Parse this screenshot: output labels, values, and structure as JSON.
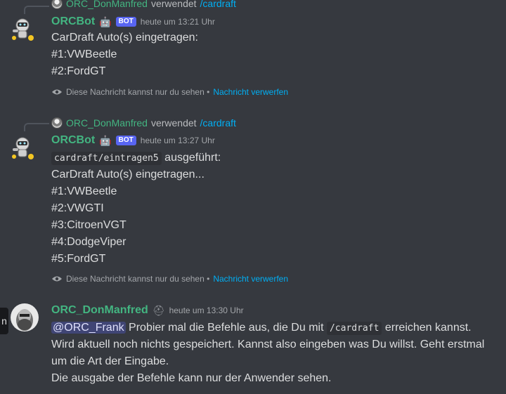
{
  "messages": [
    {
      "reply": {
        "user": "ORC_DonManfred",
        "verb": "verwendet",
        "command": "/cardraft"
      },
      "author": "ORCBot",
      "bot_tag": "BOT",
      "timestamp": "heute um 13:21 Uhr",
      "lines": [
        "CarDraft Auto(s) eingetragen:",
        "#1:VWBeetle",
        "#2:FordGT"
      ],
      "ephemeral_text": "Diese Nachricht kannst nur du sehen •",
      "ephemeral_link": "Nachricht verwerfen"
    },
    {
      "reply": {
        "user": "ORC_DonManfred",
        "verb": "verwendet",
        "command": "/cardraft"
      },
      "author": "ORCBot",
      "bot_tag": "BOT",
      "timestamp": "heute um 13:27 Uhr",
      "code": "cardraft/eintragen5",
      "code_suffix": "ausgeführt:",
      "lines": [
        "CarDraft Auto(s) eingetragen...",
        "#1:VWBeetle",
        "#2:VWGTI",
        "#3:CitroenVGT",
        "#4:DodgeViper",
        "#5:FordGT"
      ],
      "ephemeral_text": "Diese Nachricht kannst nur du sehen •",
      "ephemeral_link": "Nachricht verwerfen"
    },
    {
      "author": "ORC_DonManfred",
      "timestamp": "heute um 13:30 Uhr",
      "mention": "@ORC_Frank",
      "text_before_code": "Probier mal die Befehle aus, die Du mit",
      "code": "/cardraft",
      "text_after_code": "erreichen kannst.",
      "lines": [
        "Wird aktuell noch nichts gespeichert. Kannst also eingeben was Du willst. Geht erstmal",
        "um die Art der Eingabe.",
        "Die ausgabe der Befehle kann nur der Anwender sehen."
      ]
    }
  ],
  "tooltip_char": "n",
  "colors": {
    "background": "#36393f",
    "username": "#43b581",
    "link": "#00aff4",
    "bot_tag": "#5865f2"
  }
}
